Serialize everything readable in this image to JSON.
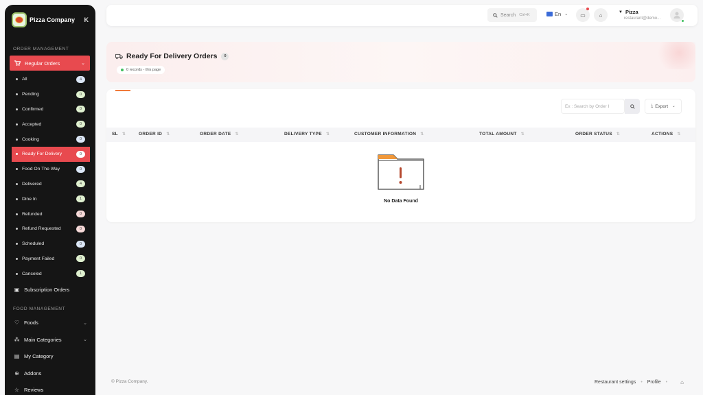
{
  "brand": {
    "name": "Pizza Company",
    "collapse_icon": "K"
  },
  "sidebar": {
    "order_section": "ORDER MANAGEMENT",
    "regular_orders": "Regular Orders",
    "sub_items": [
      {
        "label": "All",
        "count": "4",
        "color": "c-blue"
      },
      {
        "label": "Pending",
        "count": "0",
        "color": "c-green"
      },
      {
        "label": "Confirmed",
        "count": "0",
        "color": "c-green"
      },
      {
        "label": "Accepted",
        "count": "0",
        "color": "c-green"
      },
      {
        "label": "Cooking",
        "count": "0",
        "color": "c-blue"
      },
      {
        "label": "Ready For Delivery",
        "count": "0",
        "color": "c-white",
        "active": true
      },
      {
        "label": "Food On The Way",
        "count": "0",
        "color": "c-blue"
      },
      {
        "label": "Delivered",
        "count": "4",
        "color": "c-green"
      },
      {
        "label": "Dine In",
        "count": "1",
        "color": "c-green"
      },
      {
        "label": "Refunded",
        "count": "0",
        "color": "c-red"
      },
      {
        "label": "Refund Requested",
        "count": "0",
        "color": "c-red"
      },
      {
        "label": "Scheduled",
        "count": "0",
        "color": "c-blue"
      },
      {
        "label": "Payment Failed",
        "count": "0",
        "color": "c-green"
      },
      {
        "label": "Canceled",
        "count": "1",
        "color": "c-green"
      }
    ],
    "subscription_orders": "Subscription Orders",
    "food_section": "FOOD MANAGEMENT",
    "food_items": [
      {
        "label": "Foods",
        "icon": "heart-icon",
        "glyph": "♡",
        "has_chevron": true
      },
      {
        "label": "Main Categories",
        "icon": "categories-icon",
        "glyph": "⁂",
        "has_chevron": true
      },
      {
        "label": "My Category",
        "icon": "printer-icon",
        "glyph": "▤",
        "has_chevron": false
      },
      {
        "label": "Addons",
        "icon": "plus-circle-icon",
        "glyph": "⊕",
        "has_chevron": false
      },
      {
        "label": "Reviews",
        "icon": "star-icon",
        "glyph": "☆",
        "has_chevron": false
      }
    ]
  },
  "topbar": {
    "search_label": "Search",
    "search_shortcut": "Ctrl+K",
    "language": "En",
    "user_name": "Pizza",
    "user_email": "restaurant@demo..."
  },
  "page": {
    "title": "Ready For Delivery Orders",
    "count_badge": "0",
    "records_text": "0 records - this page"
  },
  "table": {
    "search_placeholder": "Ex : Search by Order I",
    "export_label": "Export",
    "columns": [
      {
        "label": "SL",
        "sortable": true
      },
      {
        "label": "ORDER ID",
        "sortable": true
      },
      {
        "label": "ORDER DATE",
        "sortable": true
      },
      {
        "label": "DELIVERY TYPE",
        "sortable": true
      },
      {
        "label": "CUSTOMER INFORMATION",
        "sortable": true
      },
      {
        "label": "TOTAL AMOUNT",
        "sortable": true
      },
      {
        "label": "ORDER STATUS",
        "sortable": true
      },
      {
        "label": "ACTIONS",
        "sortable": true
      }
    ],
    "empty_text": "No Data Found"
  },
  "footer": {
    "copyright": "© Pizza Company.",
    "links": [
      "Restaurant settings",
      "Profile"
    ]
  },
  "colors": {
    "accent": "#e84a4f",
    "sidebar_bg": "#151515",
    "tab_accent": "#f07a3a"
  }
}
